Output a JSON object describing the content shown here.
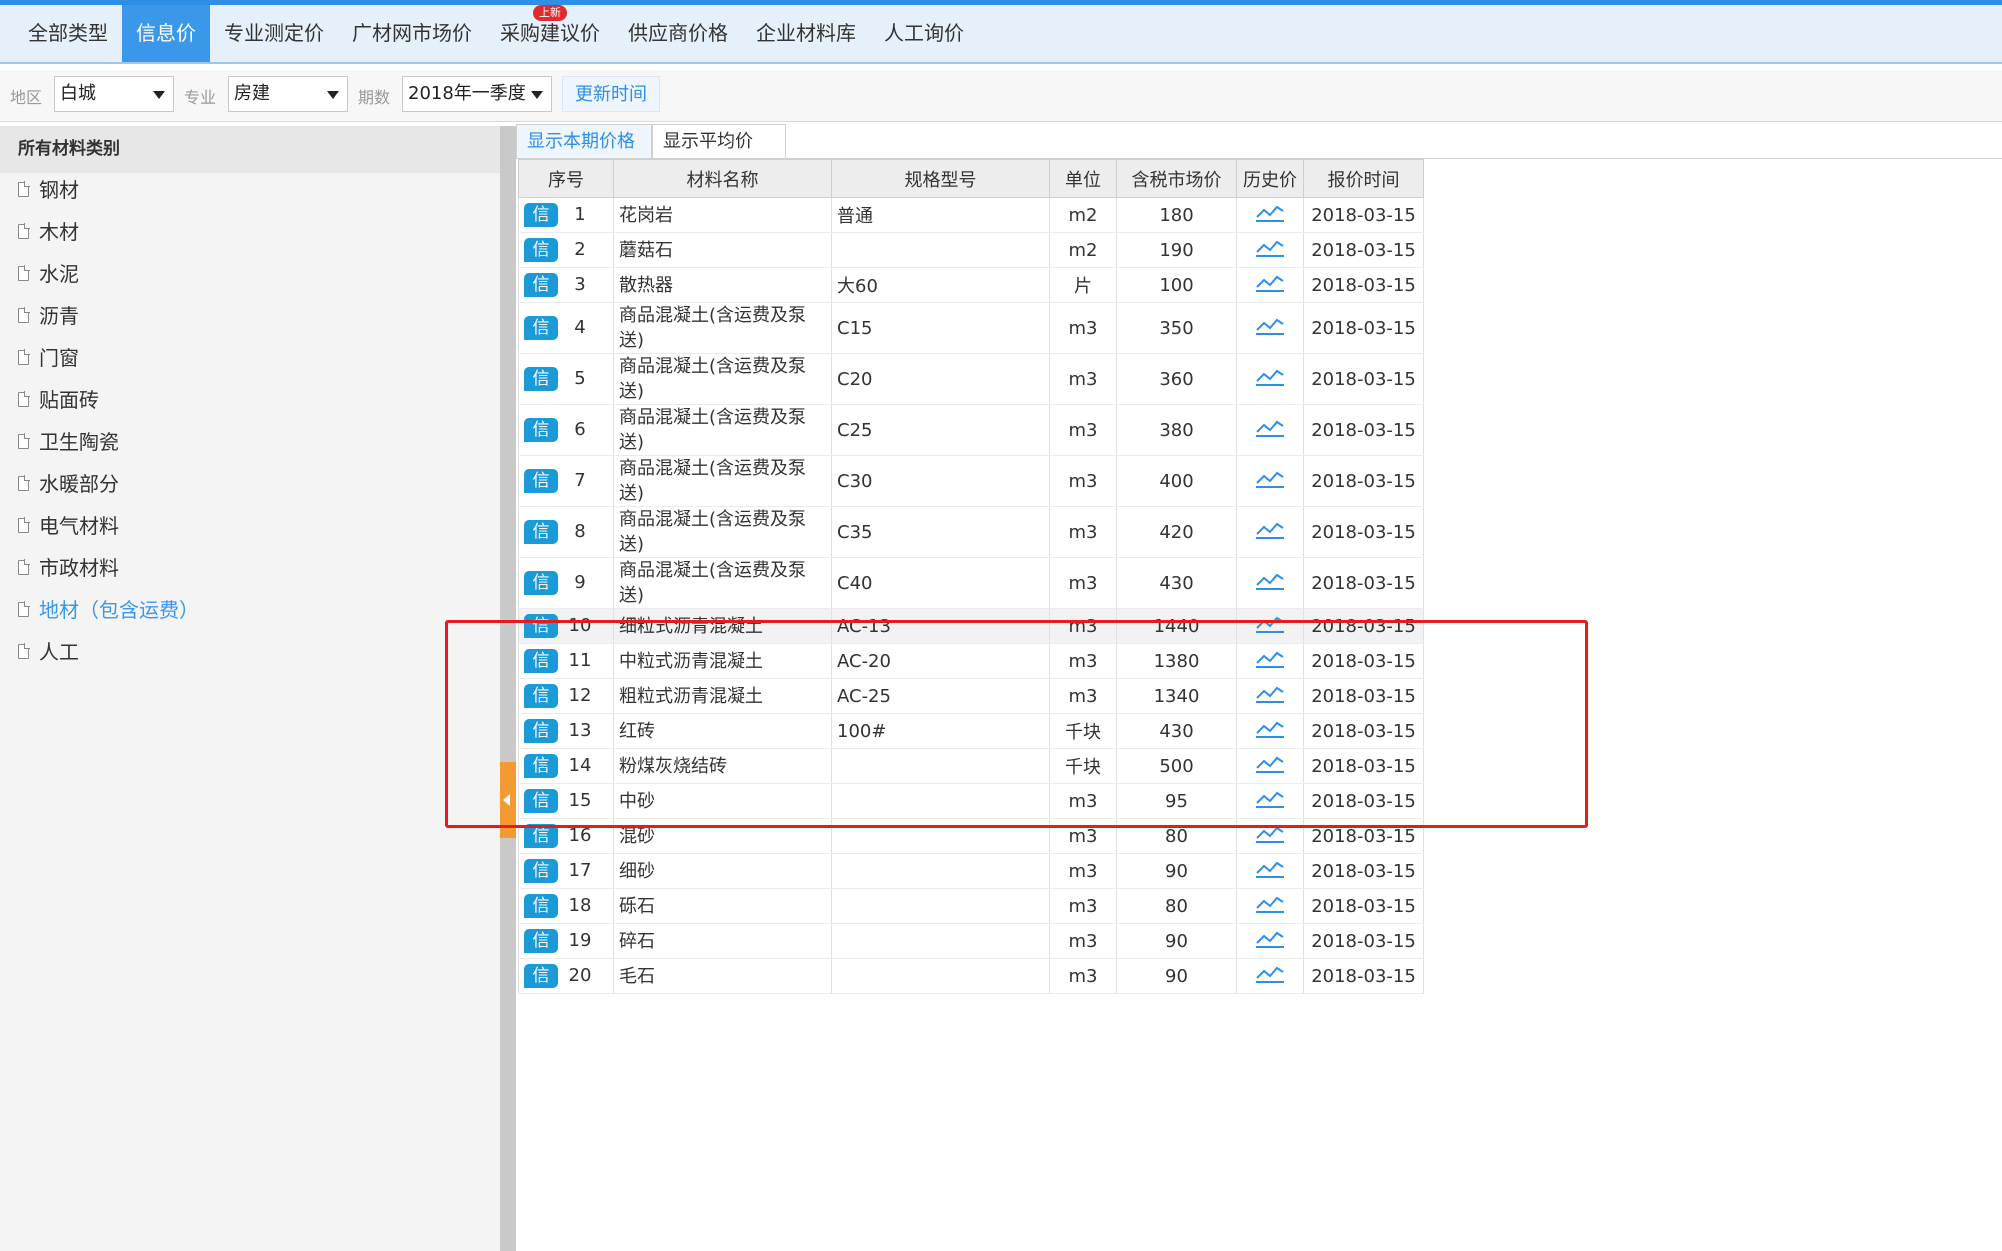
{
  "tabs": [
    {
      "label": "全部类型",
      "active": false
    },
    {
      "label": "信息价",
      "active": true
    },
    {
      "label": "专业测定价",
      "active": false
    },
    {
      "label": "广材网市场价",
      "active": false
    },
    {
      "label": "采购建议价",
      "active": false,
      "badge": "上新"
    },
    {
      "label": "供应商价格",
      "active": false
    },
    {
      "label": "企业材料库",
      "active": false
    },
    {
      "label": "人工询价",
      "active": false
    }
  ],
  "filters": {
    "region_label": "地区",
    "region_value": "白城",
    "major_label": "专业",
    "major_value": "房建",
    "period_label": "期数",
    "period_value": "2018年一季度",
    "update_button": "更新时间"
  },
  "sidebar": {
    "header": "所有材料类别",
    "items": [
      {
        "label": "钢材",
        "selected": false
      },
      {
        "label": "木材",
        "selected": false
      },
      {
        "label": "水泥",
        "selected": false
      },
      {
        "label": "沥青",
        "selected": false
      },
      {
        "label": "门窗",
        "selected": false
      },
      {
        "label": "贴面砖",
        "selected": false
      },
      {
        "label": "卫生陶瓷",
        "selected": false
      },
      {
        "label": "水暖部分",
        "selected": false
      },
      {
        "label": "电气材料",
        "selected": false
      },
      {
        "label": "市政材料",
        "selected": false
      },
      {
        "label": "地材（包含运费）",
        "selected": true
      },
      {
        "label": "人工",
        "selected": false
      }
    ]
  },
  "subtabs": {
    "current": "显示本期价格",
    "average": "显示平均价"
  },
  "table": {
    "columns": [
      "序号",
      "材料名称",
      "规格型号",
      "单位",
      "含税市场价",
      "历史价",
      "报价时间"
    ],
    "badge_text": "信",
    "rows": [
      {
        "no": "1",
        "name": "花岗岩",
        "spec": "普通",
        "unit": "m2",
        "price": "180",
        "date": "2018-03-15"
      },
      {
        "no": "2",
        "name": "蘑菇石",
        "spec": "",
        "unit": "m2",
        "price": "190",
        "date": "2018-03-15"
      },
      {
        "no": "3",
        "name": "散热器",
        "spec": "大60",
        "unit": "片",
        "price": "100",
        "date": "2018-03-15"
      },
      {
        "no": "4",
        "name": "商品混凝土(含运费及泵送)",
        "spec": "C15",
        "unit": "m3",
        "price": "350",
        "date": "2018-03-15"
      },
      {
        "no": "5",
        "name": "商品混凝土(含运费及泵送)",
        "spec": "C20",
        "unit": "m3",
        "price": "360",
        "date": "2018-03-15"
      },
      {
        "no": "6",
        "name": "商品混凝土(含运费及泵送)",
        "spec": "C25",
        "unit": "m3",
        "price": "380",
        "date": "2018-03-15"
      },
      {
        "no": "7",
        "name": "商品混凝土(含运费及泵送)",
        "spec": "C30",
        "unit": "m3",
        "price": "400",
        "date": "2018-03-15"
      },
      {
        "no": "8",
        "name": "商品混凝土(含运费及泵送)",
        "spec": "C35",
        "unit": "m3",
        "price": "420",
        "date": "2018-03-15"
      },
      {
        "no": "9",
        "name": "商品混凝土(含运费及泵送)",
        "spec": "C40",
        "unit": "m3",
        "price": "430",
        "date": "2018-03-15"
      },
      {
        "no": "10",
        "name": "细粒式沥青混凝土",
        "spec": "AC-13",
        "unit": "m3",
        "price": "1440",
        "date": "2018-03-15",
        "highlight": true
      },
      {
        "no": "11",
        "name": "中粒式沥青混凝土",
        "spec": "AC-20",
        "unit": "m3",
        "price": "1380",
        "date": "2018-03-15"
      },
      {
        "no": "12",
        "name": "粗粒式沥青混凝土",
        "spec": "AC-25",
        "unit": "m3",
        "price": "1340",
        "date": "2018-03-15"
      },
      {
        "no": "13",
        "name": "红砖",
        "spec": "100#",
        "unit": "千块",
        "price": "430",
        "date": "2018-03-15"
      },
      {
        "no": "14",
        "name": "粉煤灰烧结砖",
        "spec": "",
        "unit": "千块",
        "price": "500",
        "date": "2018-03-15"
      },
      {
        "no": "15",
        "name": "中砂",
        "spec": "",
        "unit": "m3",
        "price": "95",
        "date": "2018-03-15"
      },
      {
        "no": "16",
        "name": "混砂",
        "spec": "",
        "unit": "m3",
        "price": "80",
        "date": "2018-03-15"
      },
      {
        "no": "17",
        "name": "细砂",
        "spec": "",
        "unit": "m3",
        "price": "90",
        "date": "2018-03-15"
      },
      {
        "no": "18",
        "name": "砾石",
        "spec": "",
        "unit": "m3",
        "price": "80",
        "date": "2018-03-15"
      },
      {
        "no": "19",
        "name": "碎石",
        "spec": "",
        "unit": "m3",
        "price": "90",
        "date": "2018-03-15"
      },
      {
        "no": "20",
        "name": "毛石",
        "spec": "",
        "unit": "m3",
        "price": "90",
        "date": "2018-03-15"
      }
    ]
  },
  "colors": {
    "accent": "#3a97ea",
    "badge": "#1a9ad6",
    "annotation": "#e51c1c",
    "splitter_handle": "#f39a33"
  }
}
